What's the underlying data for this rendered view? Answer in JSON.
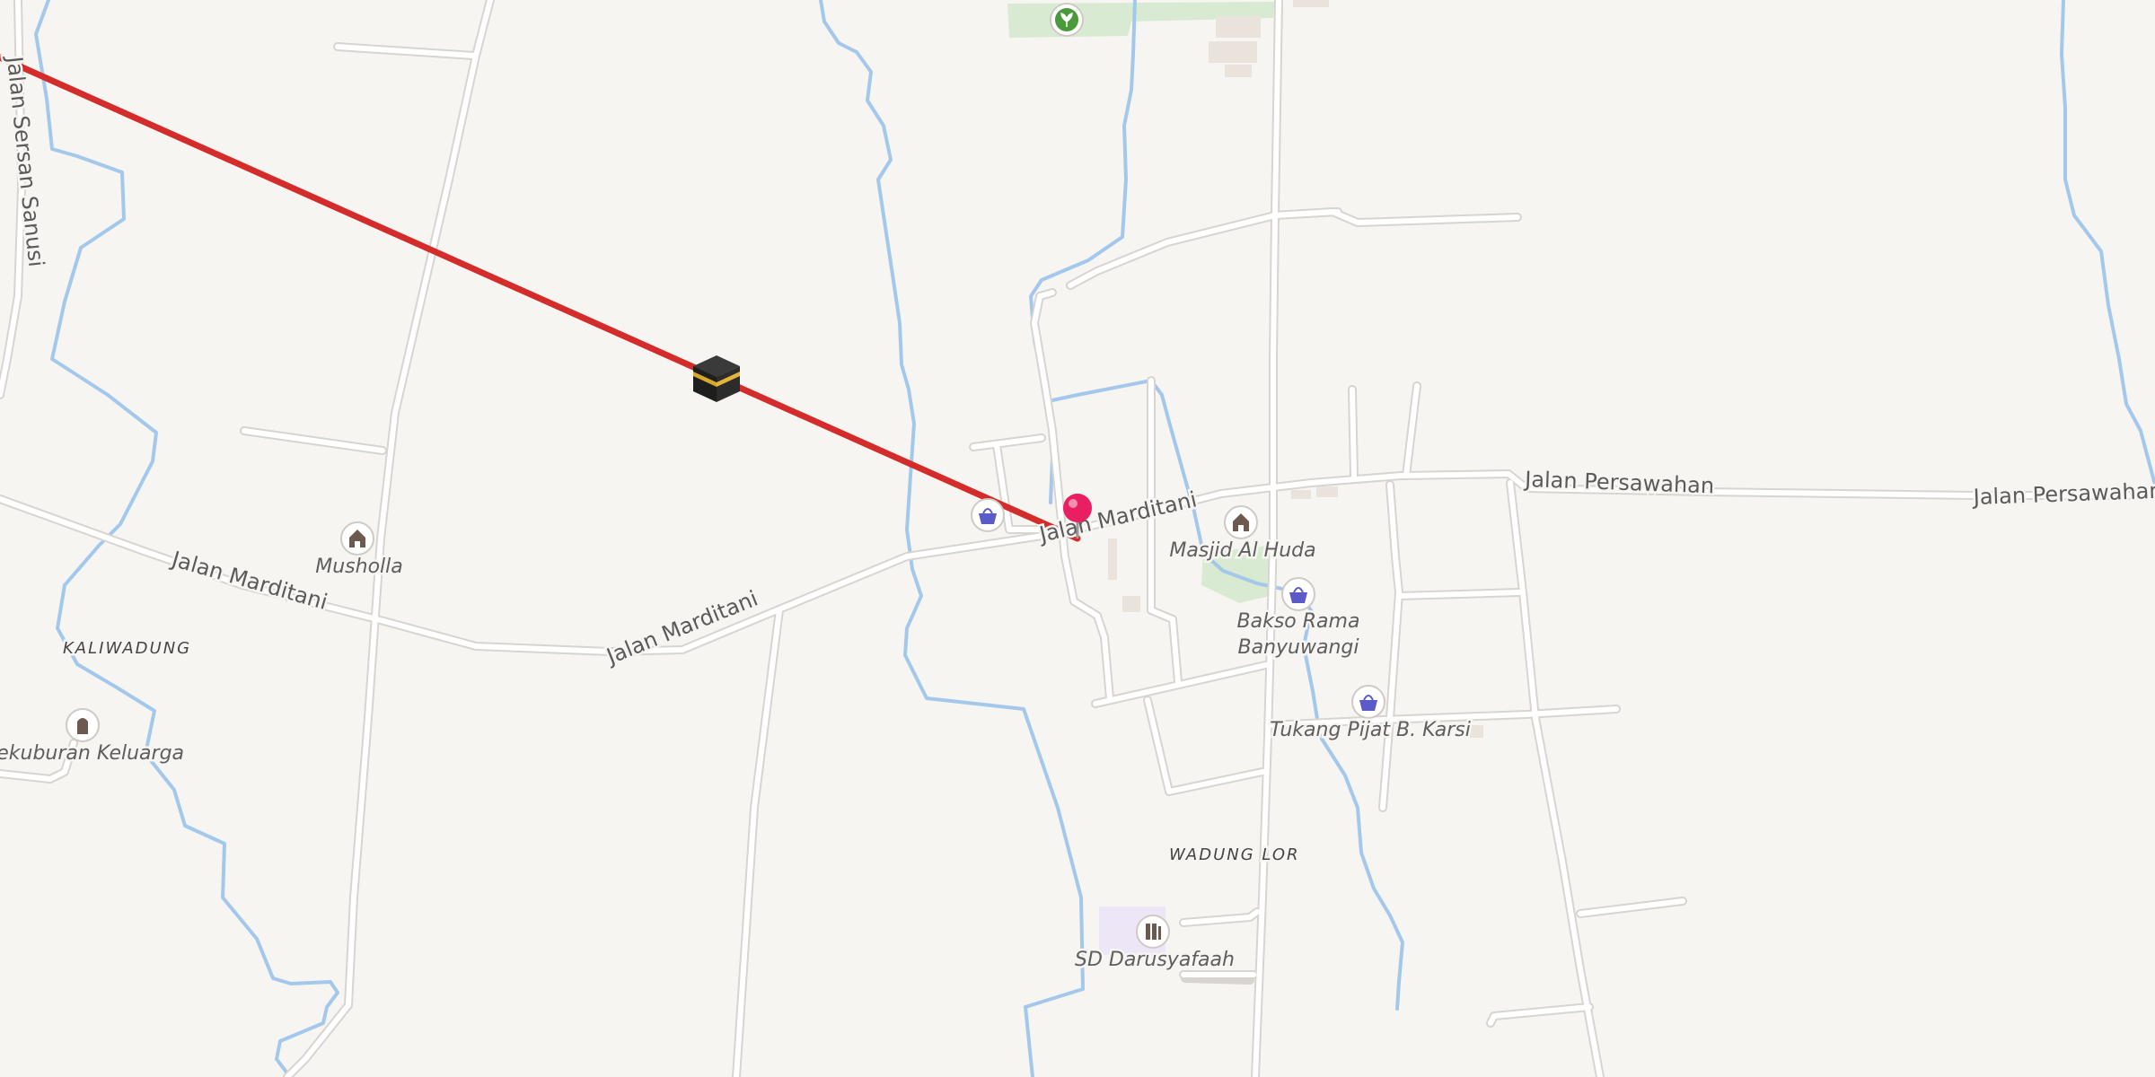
{
  "map": {
    "colors": {
      "background": "#f7f5f2",
      "road": "#ffffff",
      "road_casing": "#d8d4cf",
      "water": "#a3c8ec",
      "park": "#d9ead2",
      "school_area": "#ece6f7",
      "building": "#e9e3dc",
      "route_line": "#d42b2b",
      "pin": "#e91e63"
    },
    "roads": [
      {
        "label": "Jalan Sersan Sanusi"
      },
      {
        "label": "Jalan Marditani"
      },
      {
        "label": "Jalan Marditani"
      },
      {
        "label": "Jalan Marditani"
      },
      {
        "label": "Jalan Persawahan"
      },
      {
        "label": "Jalan Persawahan"
      }
    ],
    "areas": [
      {
        "label": "KALIWADUNG"
      },
      {
        "label": "WADUNG LOR"
      }
    ],
    "pois": [
      {
        "label": "Musholla",
        "icon": "mosque-icon"
      },
      {
        "label": "Masjid Al Huda",
        "icon": "mosque-icon"
      },
      {
        "label": "Bakso Rama\nBanyuwangi",
        "line1": "Bakso Rama",
        "line2": "Banyuwangi",
        "icon": "shop-icon"
      },
      {
        "label": "Tukang Pijat B. Karsi",
        "icon": "shop-icon"
      },
      {
        "label": "Pekuburan Keluarga",
        "icon": "cemetery-icon"
      },
      {
        "label": "SD Darusyafaah",
        "icon": "school-icon"
      },
      {
        "label": "",
        "icon": "shop-icon"
      },
      {
        "label": "",
        "icon": "garden-icon"
      }
    ],
    "markers": {
      "kaaba": {
        "icon": "kaaba-icon"
      },
      "location_pin": {
        "icon": "location-pin-icon"
      }
    }
  }
}
